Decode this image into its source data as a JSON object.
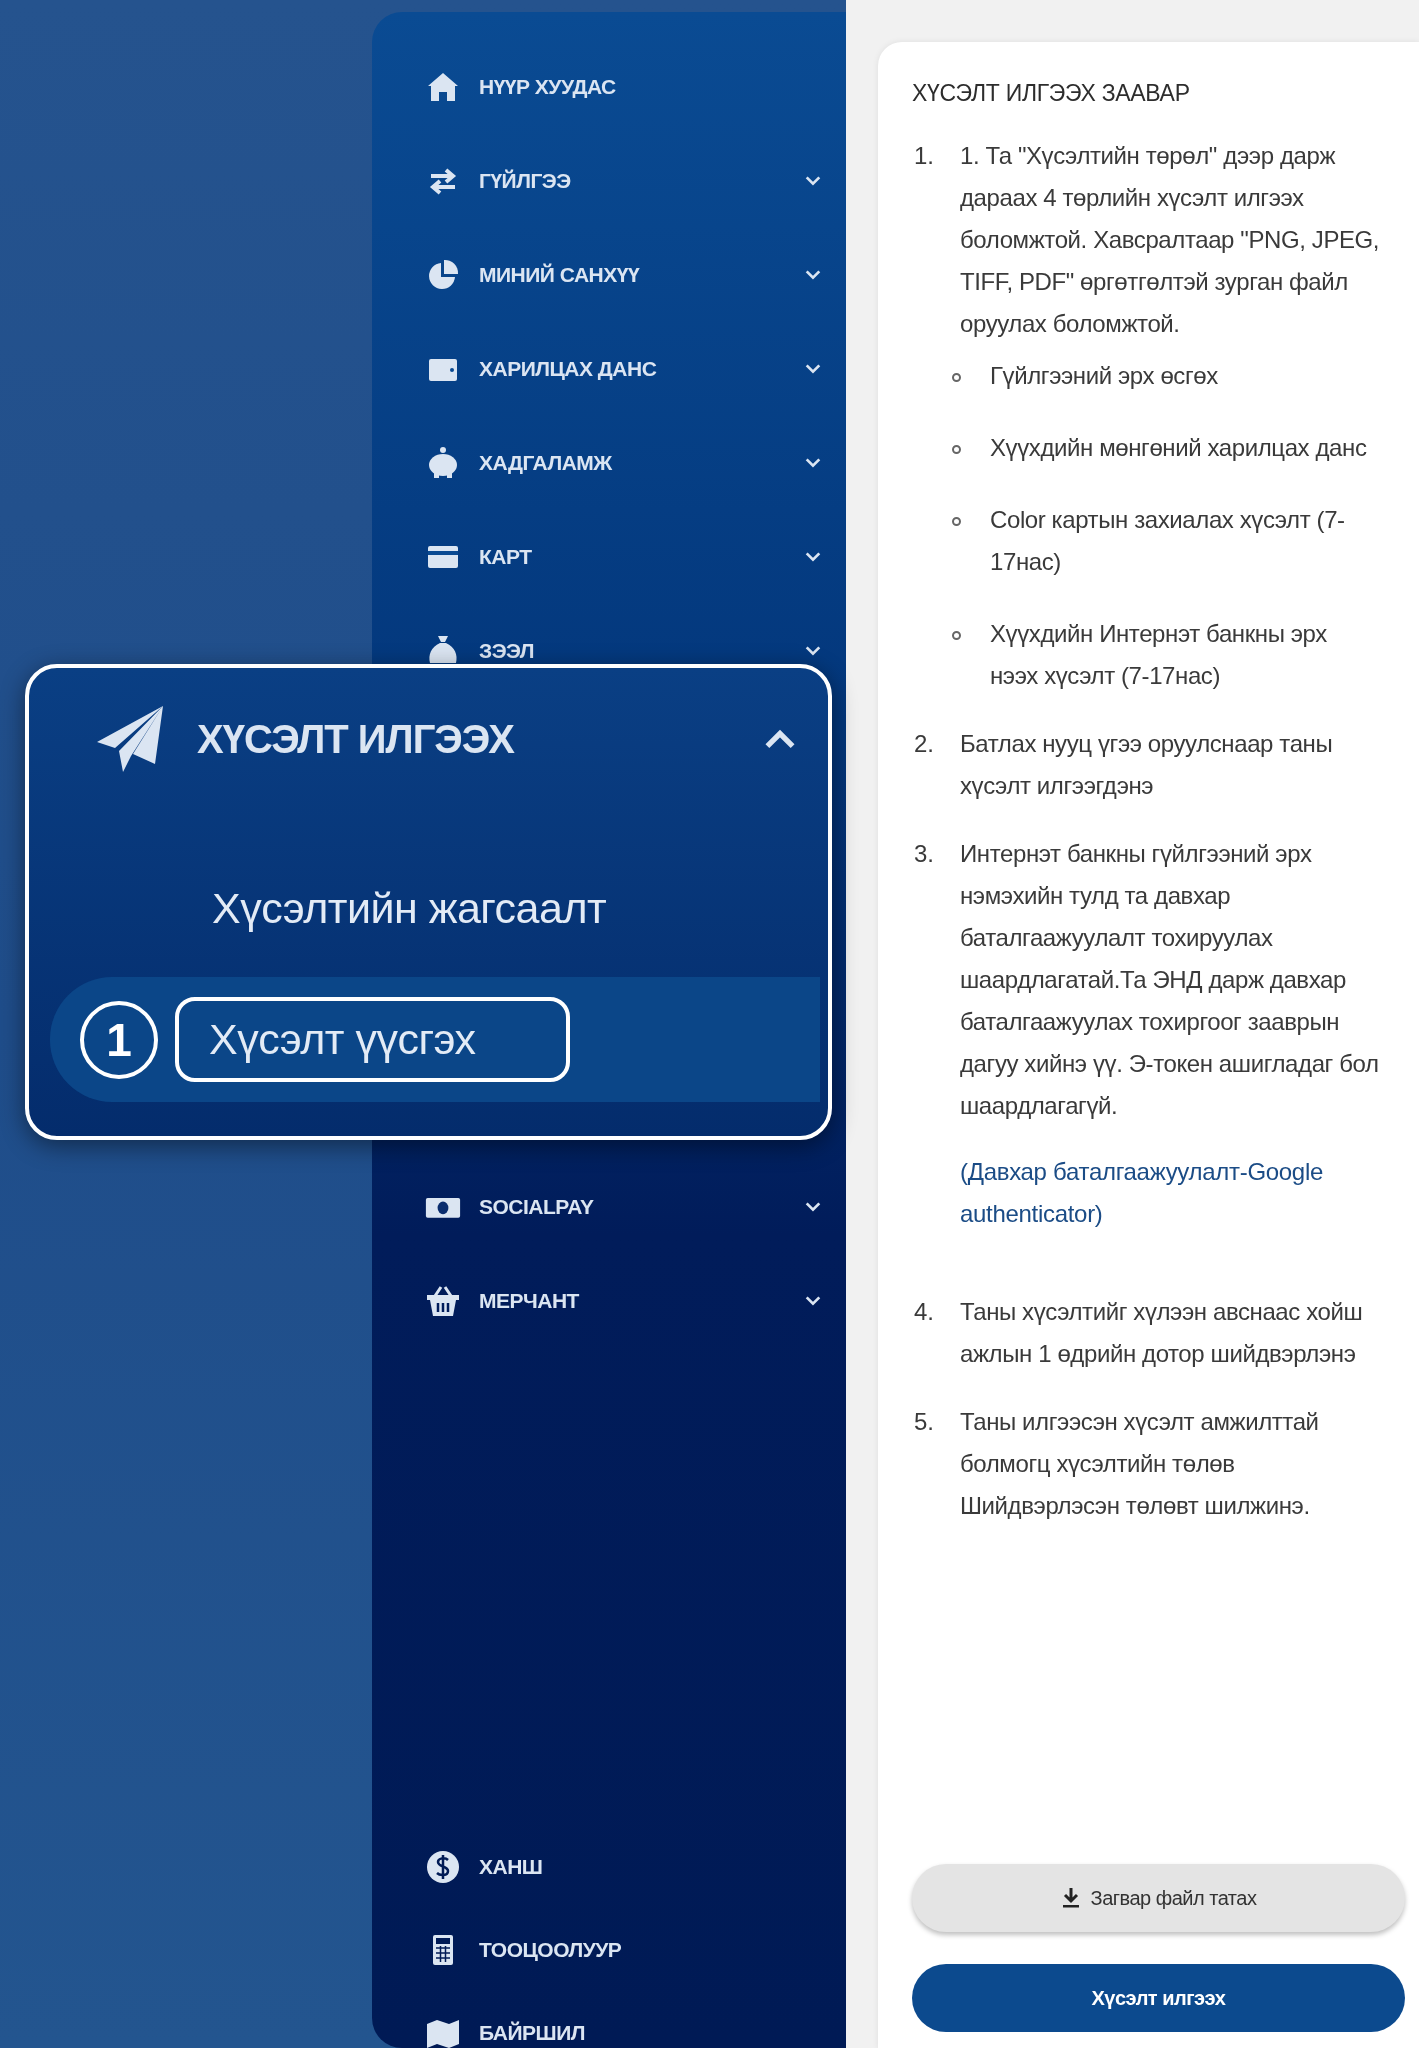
{
  "sidebar": {
    "items": [
      {
        "label": "НҮҮР ХУУДАС"
      },
      {
        "label": "ГҮЙЛГЭЭ",
        "kind": "menu",
        "expanded": false
      },
      {
        "label": "МИНИЙ САНХҮҮ",
        "kind": "menu",
        "expanded": false
      },
      {
        "label": "ХАРИЛЦАХ ДАНС",
        "kind": "menu",
        "expanded": false
      },
      {
        "label": "ХАДГАЛАМЖ",
        "kind": "menu",
        "expanded": false
      },
      {
        "label": "КАРТ",
        "kind": "menu",
        "expanded": false
      },
      {
        "label": "ЗЭЭЛ",
        "kind": "menu",
        "expanded": false
      },
      {
        "label": "ХҮСЭЛТ ИЛГЭЭХ",
        "kind": "group",
        "expanded": true,
        "children": [
          {
            "label": "Хүсэлтийн жагсаалт",
            "selected": false
          },
          {
            "label": "Хүсэлт үүсгэх",
            "selected": true,
            "step_badge": "1"
          }
        ]
      },
      {
        "label": "SOCIALPAY",
        "kind": "menu",
        "expanded": false
      },
      {
        "label": "МЕРЧАНТ",
        "kind": "menu",
        "expanded": false
      }
    ],
    "bottom_items": [
      {
        "label": "ХАНШ"
      },
      {
        "label": "ТООЦООЛУУР"
      },
      {
        "label": "БАЙРШИЛ"
      }
    ]
  },
  "instructions": {
    "title": "ХҮСЭЛТ ИЛГЭЭХ ЗААВАР",
    "steps": [
      {
        "number": "1.",
        "text": "1. Та \"Хүсэлтийн төрөл\" дээр дарж дараах 4 төрлийн хүсэлт илгээх боломжтой. Хавсралтаар \"PNG, JPEG, TIFF, PDF\" өргөтгөлтэй зурган файл оруулах боломжтой.",
        "bullets": [
          "Гүйлгээний эрх өсгөх",
          "Хүүхдийн мөнгөний харилцах данс",
          "Color картын захиалах хүсэлт (7-17нас)",
          "Хүүхдийн Интернэт банкны эрх нээх хүсэлт (7-17нас)"
        ]
      },
      {
        "number": "2.",
        "text": "Батлах нууц үгээ оруулснаар таны хүсэлт илгээгдэнэ"
      },
      {
        "number": "3.",
        "text": "Интернэт банкны гүйлгээний эрх нэмэхийн тулд та давхар баталгаажуулалт тохируулах шаардлагатай.Та ЭНД дарж давхар баталгаажуулах тохиргоог зааврын дагуу хийнэ үү. Э-токен ашигладаг бол шаардлагагүй.",
        "link": "(Давхар баталгаажуулалт-Google authenticator)"
      },
      {
        "number": "4.",
        "text": "Таны хүсэлтийг хүлээн авснаас хойш ажлын 1 өдрийн дотор шийдвэрлэнэ"
      },
      {
        "number": "5.",
        "text": "Таны илгээсэн хүсэлт амжилттай болмогц хүсэлтийн төлөв Шийдвэрлэсэн төлөвт шилжинэ."
      }
    ]
  },
  "buttons": [
    {
      "label": "Загвар файл татах",
      "kind": "download"
    },
    {
      "label": "Хүсэлт илгээх",
      "kind": "primary"
    }
  ]
}
